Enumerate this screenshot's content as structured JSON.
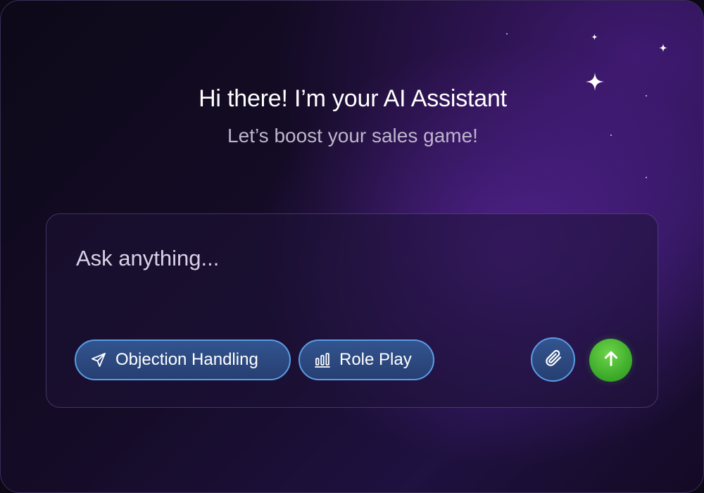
{
  "header": {
    "title": "Hi there! I’m your AI Assistant",
    "subtitle": "Let’s boost your sales game!"
  },
  "composer": {
    "placeholder": "Ask anything..."
  },
  "chips": [
    {
      "label": "Objection Handling",
      "icon": "send-plane-icon"
    },
    {
      "label": "Role Play",
      "icon": "bar-chart-icon"
    }
  ],
  "actions": {
    "attach_icon": "paperclip-icon",
    "send_icon": "arrow-up-icon"
  },
  "colors": {
    "background": "#120b22",
    "accent_purple": "#5b2aa0",
    "chip_border": "#5a9de6",
    "chip_fill": "#2c4a80",
    "send_green": "#4cbc34"
  }
}
